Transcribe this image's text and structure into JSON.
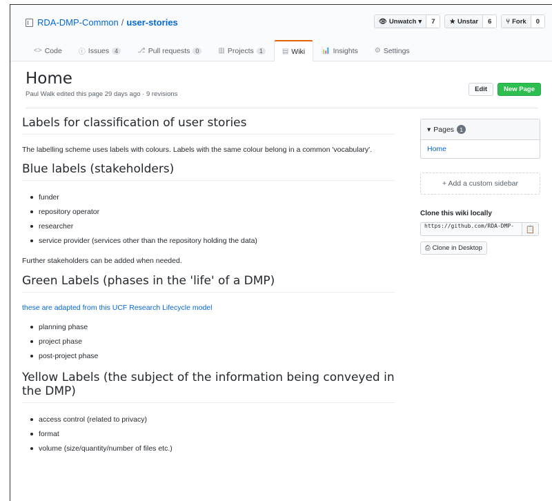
{
  "repo": {
    "owner": "RDA-DMP-Common",
    "separator": "/",
    "name": "user-stories"
  },
  "actions": {
    "unwatch_label": "Unwatch",
    "unwatch_count": "7",
    "unstar_label": "Unstar",
    "unstar_count": "6",
    "fork_label": "Fork",
    "fork_count": "0"
  },
  "tabs": [
    {
      "icon": "<>",
      "label": "Code",
      "count": ""
    },
    {
      "icon": "ⓘ",
      "label": "Issues",
      "count": "4"
    },
    {
      "icon": "⎇",
      "label": "Pull requests",
      "count": "0"
    },
    {
      "icon": "▥",
      "label": "Projects",
      "count": "1"
    },
    {
      "icon": "▤",
      "label": "Wiki",
      "count": ""
    },
    {
      "icon": "📊",
      "label": "Insights",
      "count": ""
    },
    {
      "icon": "⚙",
      "label": "Settings",
      "count": ""
    }
  ],
  "page": {
    "title": "Home",
    "meta": "Paul Walk edited this page 29 days ago · 9 revisions",
    "edit_label": "Edit",
    "new_page_label": "New Page"
  },
  "content": {
    "h1": "Labels for classification of user stories",
    "intro": "The labelling scheme uses labels with colours. Labels with the same colour belong in a common 'vocabulary'.",
    "h2": "Blue labels (stakeholders)",
    "blue_items": [
      "funder",
      "repository operator",
      "researcher",
      "service provider (services other than the repository holding the data)"
    ],
    "blue_note": "Further stakeholders can be added when needed.",
    "h3": "Green Labels (phases in the 'life' of a DMP)",
    "green_link": "these are adapted from this UCF Research Lifecycle model",
    "green_items": [
      "planning phase",
      "project phase",
      "post-project phase"
    ],
    "h4": "Yellow Labels (the subject of the information being conveyed in the DMP)",
    "yellow_items": [
      "access control (related to privacy)",
      "format",
      "volume (size/quantity/number of files etc.)"
    ]
  },
  "sidebar": {
    "pages_label": "Pages",
    "pages_count": "1",
    "page_item": "Home",
    "add_sidebar": "+ Add a custom sidebar",
    "clone_label": "Clone this wiki locally",
    "clone_url": "https://github.com/RDA-DMP-",
    "clone_desktop": "Clone in Desktop"
  }
}
